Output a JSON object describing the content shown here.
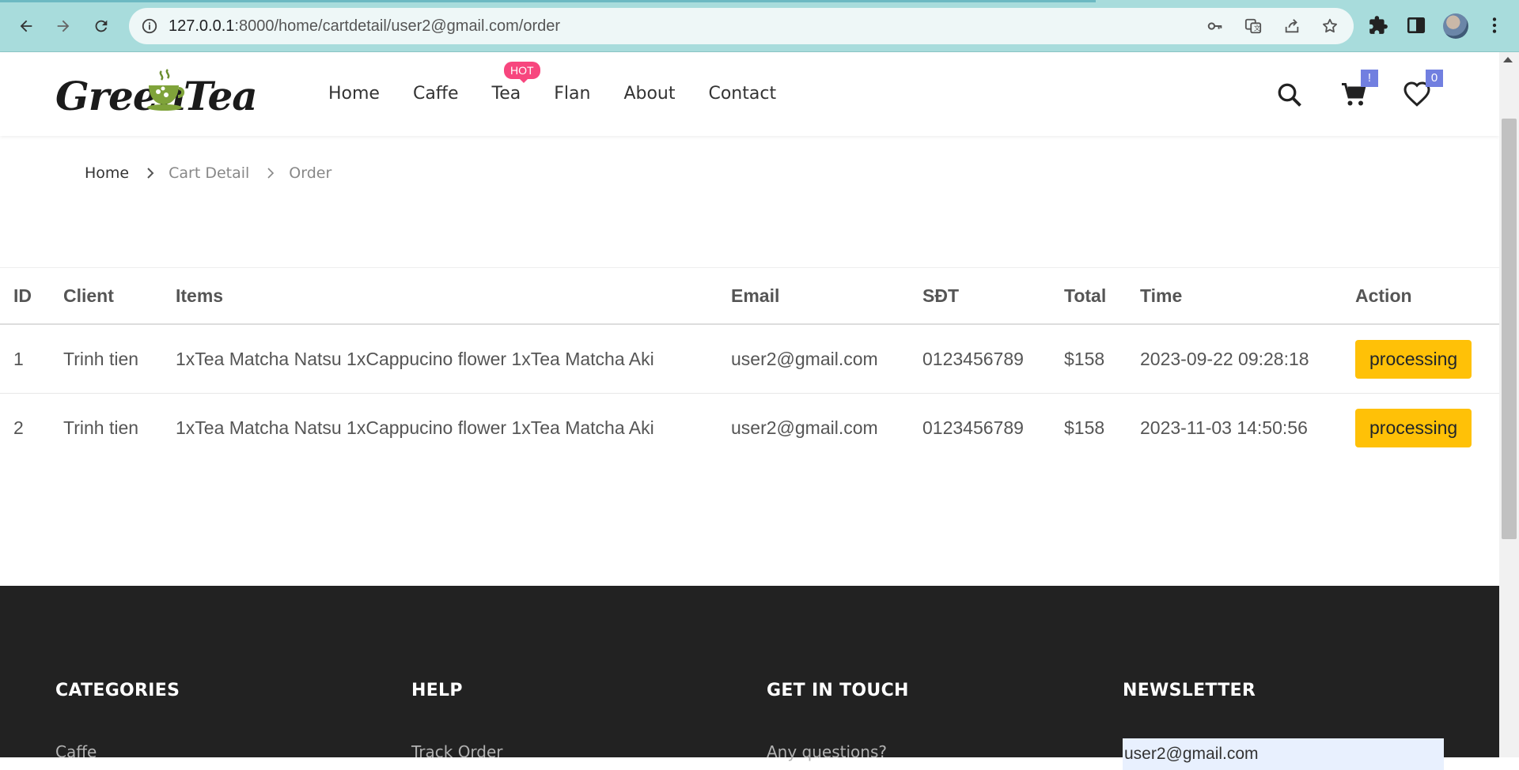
{
  "browser": {
    "url_host": "127.0.0.1",
    "url_path": ":8000/home/cartdetail/user2@gmail.com/order"
  },
  "header": {
    "logo": {
      "word1": "Green",
      "word2": "Tea"
    },
    "menu": [
      {
        "label": "Home"
      },
      {
        "label": "Caffe"
      },
      {
        "label": "Tea"
      },
      {
        "label": "Flan"
      },
      {
        "label": "About"
      },
      {
        "label": "Contact"
      }
    ],
    "hot_badge": "HOT",
    "cart_badge": "!",
    "wishlist_badge": "0"
  },
  "breadcrumb": {
    "home": "Home",
    "cart_detail": "Cart Detail",
    "current": "Order"
  },
  "orders": {
    "columns": [
      "ID",
      "Client",
      "Items",
      "Email",
      "SĐT",
      "Total",
      "Time",
      "Action"
    ],
    "rows": [
      {
        "id": "1",
        "client": "Trinh tien",
        "items": "1xTea Matcha Natsu 1xCappucino flower 1xTea Matcha Aki",
        "email": "user2@gmail.com",
        "phone": "0123456789",
        "total": "$158",
        "time": "2023-09-22 09:28:18",
        "action": "processing"
      },
      {
        "id": "2",
        "client": "Trinh tien",
        "items": "1xTea Matcha Natsu 1xCappucino flower 1xTea Matcha Aki",
        "email": "user2@gmail.com",
        "phone": "0123456789",
        "total": "$158",
        "time": "2023-11-03 14:50:56",
        "action": "processing"
      }
    ]
  },
  "footer": {
    "categories_title": "CATEGORIES",
    "help_title": "HELP",
    "contact_title": "GET IN TOUCH",
    "newsletter_title": "NEWSLETTER",
    "categories_first": "Caffe",
    "help_first": "Track Order",
    "contact_first": "Any questions?",
    "newsletter_value": "user2@gmail.com"
  },
  "colors": {
    "chrome_bg": "#a8dcdc",
    "accent_badge": "#717fe0",
    "hot_badge": "#f7467e",
    "status_button": "#ffc107",
    "footer_bg": "#222222"
  }
}
